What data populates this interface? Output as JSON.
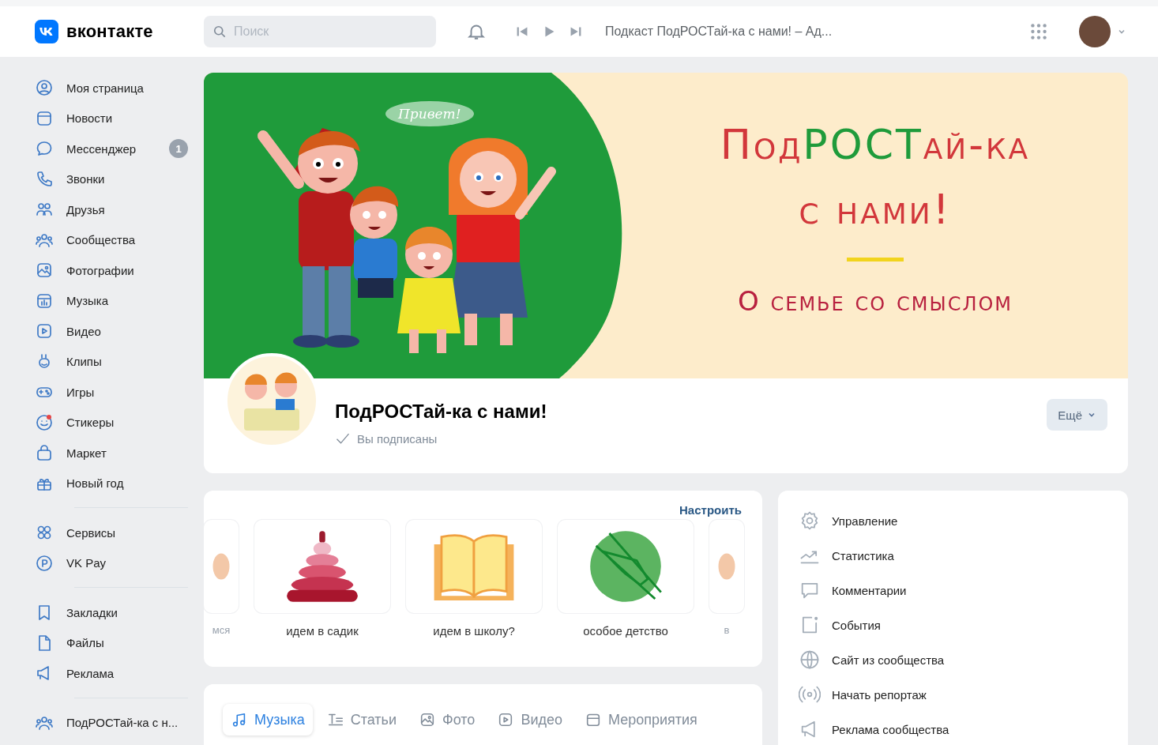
{
  "header": {
    "logo_text": "вконтакте",
    "search": {
      "placeholder": "Поиск"
    },
    "player": {
      "track": "Подкаст ПодРОСТай-ка с нами! – Ад..."
    }
  },
  "sidebar": {
    "groups": [
      {
        "items": [
          {
            "label": "Моя страница"
          },
          {
            "label": "Новости"
          },
          {
            "label": "Мессенджер",
            "badge": "1"
          },
          {
            "label": "Звонки"
          },
          {
            "label": "Друзья"
          },
          {
            "label": "Сообщества"
          },
          {
            "label": "Фотографии"
          },
          {
            "label": "Музыка"
          },
          {
            "label": "Видео"
          },
          {
            "label": "Клипы"
          },
          {
            "label": "Игры"
          },
          {
            "label": "Стикеры"
          },
          {
            "label": "Маркет"
          },
          {
            "label": "Новый год"
          }
        ]
      },
      {
        "items": [
          {
            "label": "Сервисы"
          },
          {
            "label": "VK Pay"
          }
        ]
      },
      {
        "items": [
          {
            "label": "Закладки"
          },
          {
            "label": "Файлы"
          },
          {
            "label": "Реклама"
          }
        ]
      },
      {
        "items": [
          {
            "label": "ПодРОСТай-ка с н..."
          }
        ]
      }
    ]
  },
  "cover": {
    "bubble": "Привет!",
    "title_parts": [
      {
        "text": "Под",
        "accent": false
      },
      {
        "text": "РОСТ",
        "accent": true
      },
      {
        "text": "ай-ка",
        "accent": false
      }
    ],
    "title_line2": "с нами!",
    "subtitle": "О семье со смыслом"
  },
  "profile": {
    "name": "ПодРОСТай-ка с нами!",
    "status": "Вы подписаны",
    "more_button": "Ещё"
  },
  "playlists": {
    "action": "Настроить",
    "items": [
      {
        "label": "мся",
        "kind": "partial"
      },
      {
        "label": "идем в садик",
        "kind": "pyramid"
      },
      {
        "label": "идем в школу?",
        "kind": "book"
      },
      {
        "label": "особое детство",
        "kind": "hands"
      },
      {
        "label": "в",
        "kind": "partial"
      }
    ]
  },
  "tabs": [
    {
      "label": "Музыка",
      "selected": true
    },
    {
      "label": "Статьи",
      "selected": false
    },
    {
      "label": "Фото",
      "selected": false
    },
    {
      "label": "Видео",
      "selected": false
    },
    {
      "label": "Мероприятия",
      "selected": false
    }
  ],
  "admin_menu": [
    {
      "label": "Управление"
    },
    {
      "label": "Статистика"
    },
    {
      "label": "Комментарии"
    },
    {
      "label": "События"
    },
    {
      "label": "Сайт из сообщества"
    },
    {
      "label": "Начать репортаж"
    },
    {
      "label": "Реклама сообщества"
    }
  ]
}
